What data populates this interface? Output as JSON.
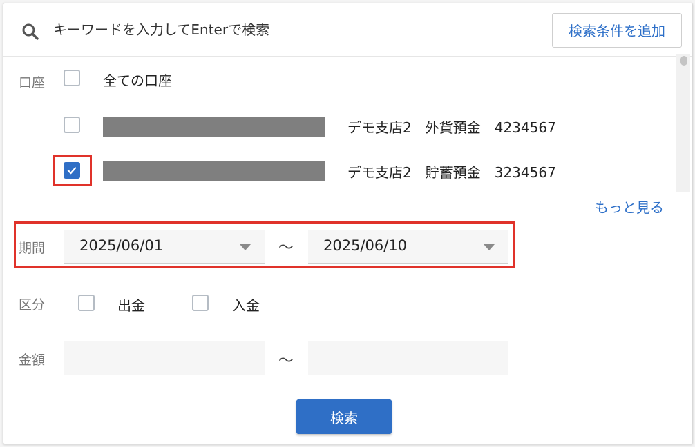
{
  "search": {
    "placeholder": "キーワードを入力してEnterで検索",
    "add_condition_label": "検索条件を追加"
  },
  "accounts": {
    "label": "口座",
    "all_label": "全ての口座",
    "all_checked": false,
    "items": [
      {
        "name": "デモ支店2　外貨預金　4234567",
        "checked": false
      },
      {
        "name": "デモ支店2　貯蓄預金　3234567",
        "checked": true
      }
    ],
    "more_label": "もっと見る"
  },
  "period": {
    "label": "期間",
    "from": "2025/06/01",
    "separator": "〜",
    "to": "2025/06/10"
  },
  "category": {
    "label": "区分",
    "options": [
      {
        "label": "出金",
        "checked": false
      },
      {
        "label": "入金",
        "checked": false
      }
    ]
  },
  "amount": {
    "label": "金額",
    "separator": "〜",
    "from": "",
    "to": ""
  },
  "submit_label": "検索",
  "colors": {
    "accent": "#2f6fc6",
    "highlight": "#e0322a",
    "link": "#2d6fc8"
  }
}
